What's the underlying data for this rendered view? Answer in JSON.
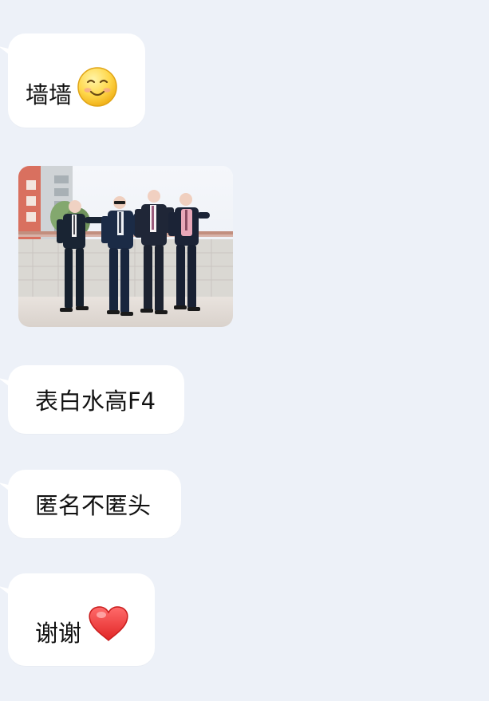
{
  "messages": [
    {
      "type": "text",
      "text": "墙墙",
      "emoji": "smile-emoji"
    },
    {
      "type": "image",
      "image": "four-men-in-suits-photo"
    },
    {
      "type": "text",
      "text": "表白水高F4"
    },
    {
      "type": "text",
      "text": "匿名不匿头"
    },
    {
      "type": "text",
      "text": "谢谢",
      "emoji": "red-heart-emoji"
    }
  ],
  "colors": {
    "background": "#edf1f8",
    "bubble": "#ffffff",
    "text": "#111111"
  }
}
